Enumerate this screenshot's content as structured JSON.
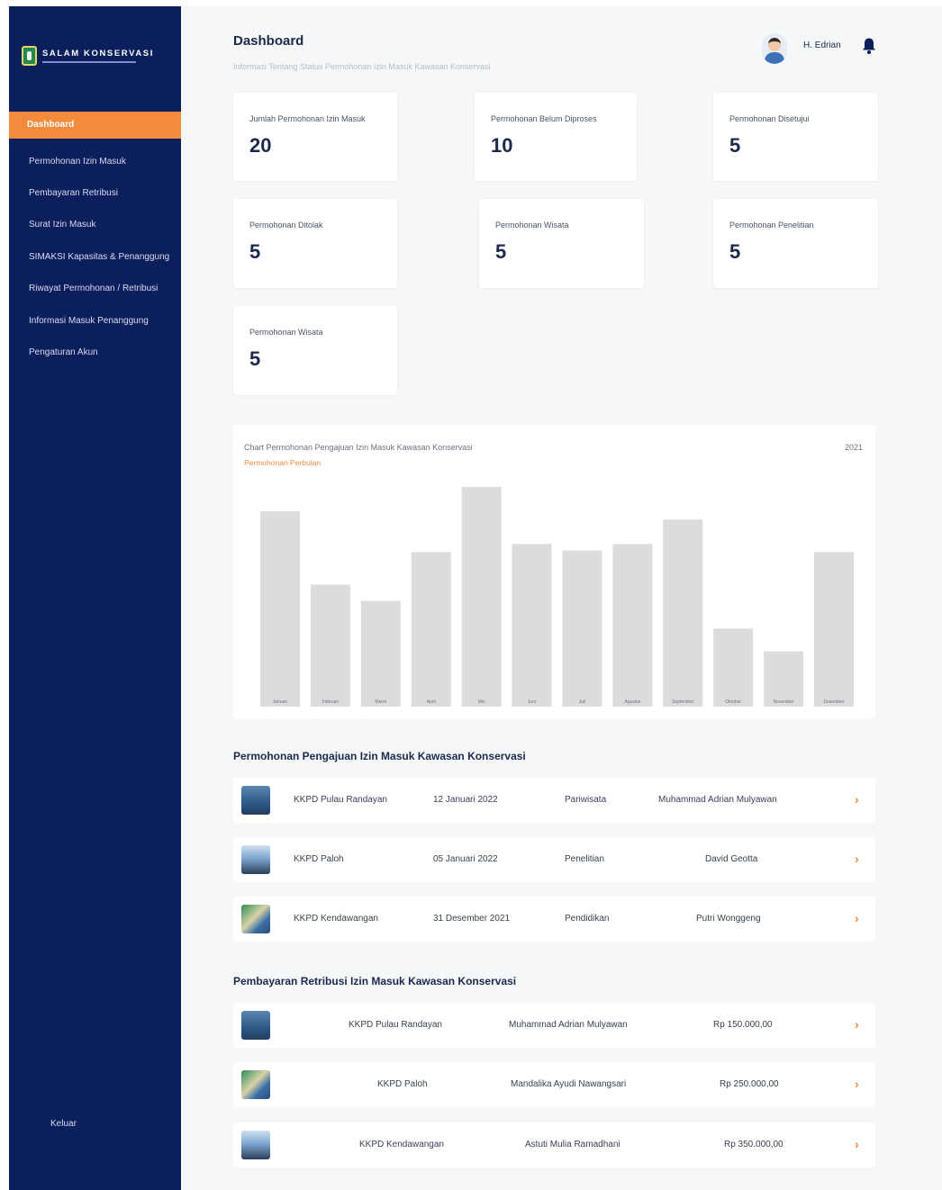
{
  "sidebar": {
    "app_title": "SALAM KONSERVASI",
    "active_item": "Dashboard",
    "items": [
      "Permohonan Izin Masuk",
      "Pembayaran Retribusi",
      "Surat Izin Masuk",
      "SIMAKSI Kapasitas & Penanggung",
      "Riwayat Permohonan / Retribusi",
      "Informasi Masuk Penanggung",
      "Pengaturan Akun"
    ],
    "logout": "Keluar"
  },
  "header": {
    "title": "Dashboard",
    "subtitle": "Informasi Tentang Status Permohonan Izin Masuk Kawasan Konservasi",
    "user_name": "H. Edrian"
  },
  "stats": [
    {
      "label": "Jumlah Permohonan Izin Masuk",
      "value": "20"
    },
    {
      "label": "Permohonan Belum Diproses",
      "value": "10"
    },
    {
      "label": "Permohonan Disetujui",
      "value": "5"
    },
    {
      "label": "Permohonan Ditolak",
      "value": "5"
    },
    {
      "label": "Permohonan Wisata",
      "value": "5"
    },
    {
      "label": "Permohonan Penelitian",
      "value": "5"
    },
    {
      "label": "Permohonan Wisata",
      "value": "5"
    }
  ],
  "chart": {
    "title": "Chart Permohonan Pengajuan Izin Masuk Kawasan Konservasi",
    "legend": "Permohonan Perbulan",
    "year": "2021",
    "bar_color": "#dcdcdc"
  },
  "chart_data": {
    "type": "bar",
    "categories": [
      "Januari",
      "Februari",
      "Maret",
      "April",
      "Mei",
      "Juni",
      "Juli",
      "Agustus",
      "September",
      "Oktober",
      "November",
      "Desember"
    ],
    "values": [
      12,
      7.5,
      6.5,
      9.5,
      13.5,
      10,
      9.6,
      10,
      11.5,
      4.8,
      3.4,
      9.5
    ],
    "ylim": [
      0,
      14
    ]
  },
  "section_requests": {
    "title": "Permohonan Pengajuan Izin Masuk Kawasan Konservasi",
    "rows": [
      {
        "location": "KKPD Pulau Randayan",
        "date": "12 Januari 2022",
        "category": "Pariwisata",
        "name": "Muhammad Adrian Mulyawan",
        "thumb": "sea"
      },
      {
        "location": "KKPD Paloh",
        "date": "05 Januari 2022",
        "category": "Penelitian",
        "name": "David Geotta",
        "thumb": "sky"
      },
      {
        "location": "KKPD Kendawangan",
        "date": "31 Desember 2021",
        "category": "Pendidikan",
        "name": "Putri Wonggeng",
        "thumb": "coast"
      }
    ]
  },
  "section_payments": {
    "title": "Pembayaran Retribusi Izin Masuk Kawasan Konservasi",
    "rows": [
      {
        "location": "KKPD Pulau Randayan",
        "name": "Muhammad Adrian Mulyawan",
        "amount": "Rp 150.000,00",
        "thumb": "sea"
      },
      {
        "location": "KKPD Paloh",
        "name": "Mandalika Ayudi Nawangsari",
        "amount": "Rp 250.000,00",
        "thumb": "coast"
      },
      {
        "location": "KKPD Kendawangan",
        "name": "Astuti Mulia Ramadhani",
        "amount": "Rp 350.000,00",
        "thumb": "sky"
      }
    ]
  }
}
